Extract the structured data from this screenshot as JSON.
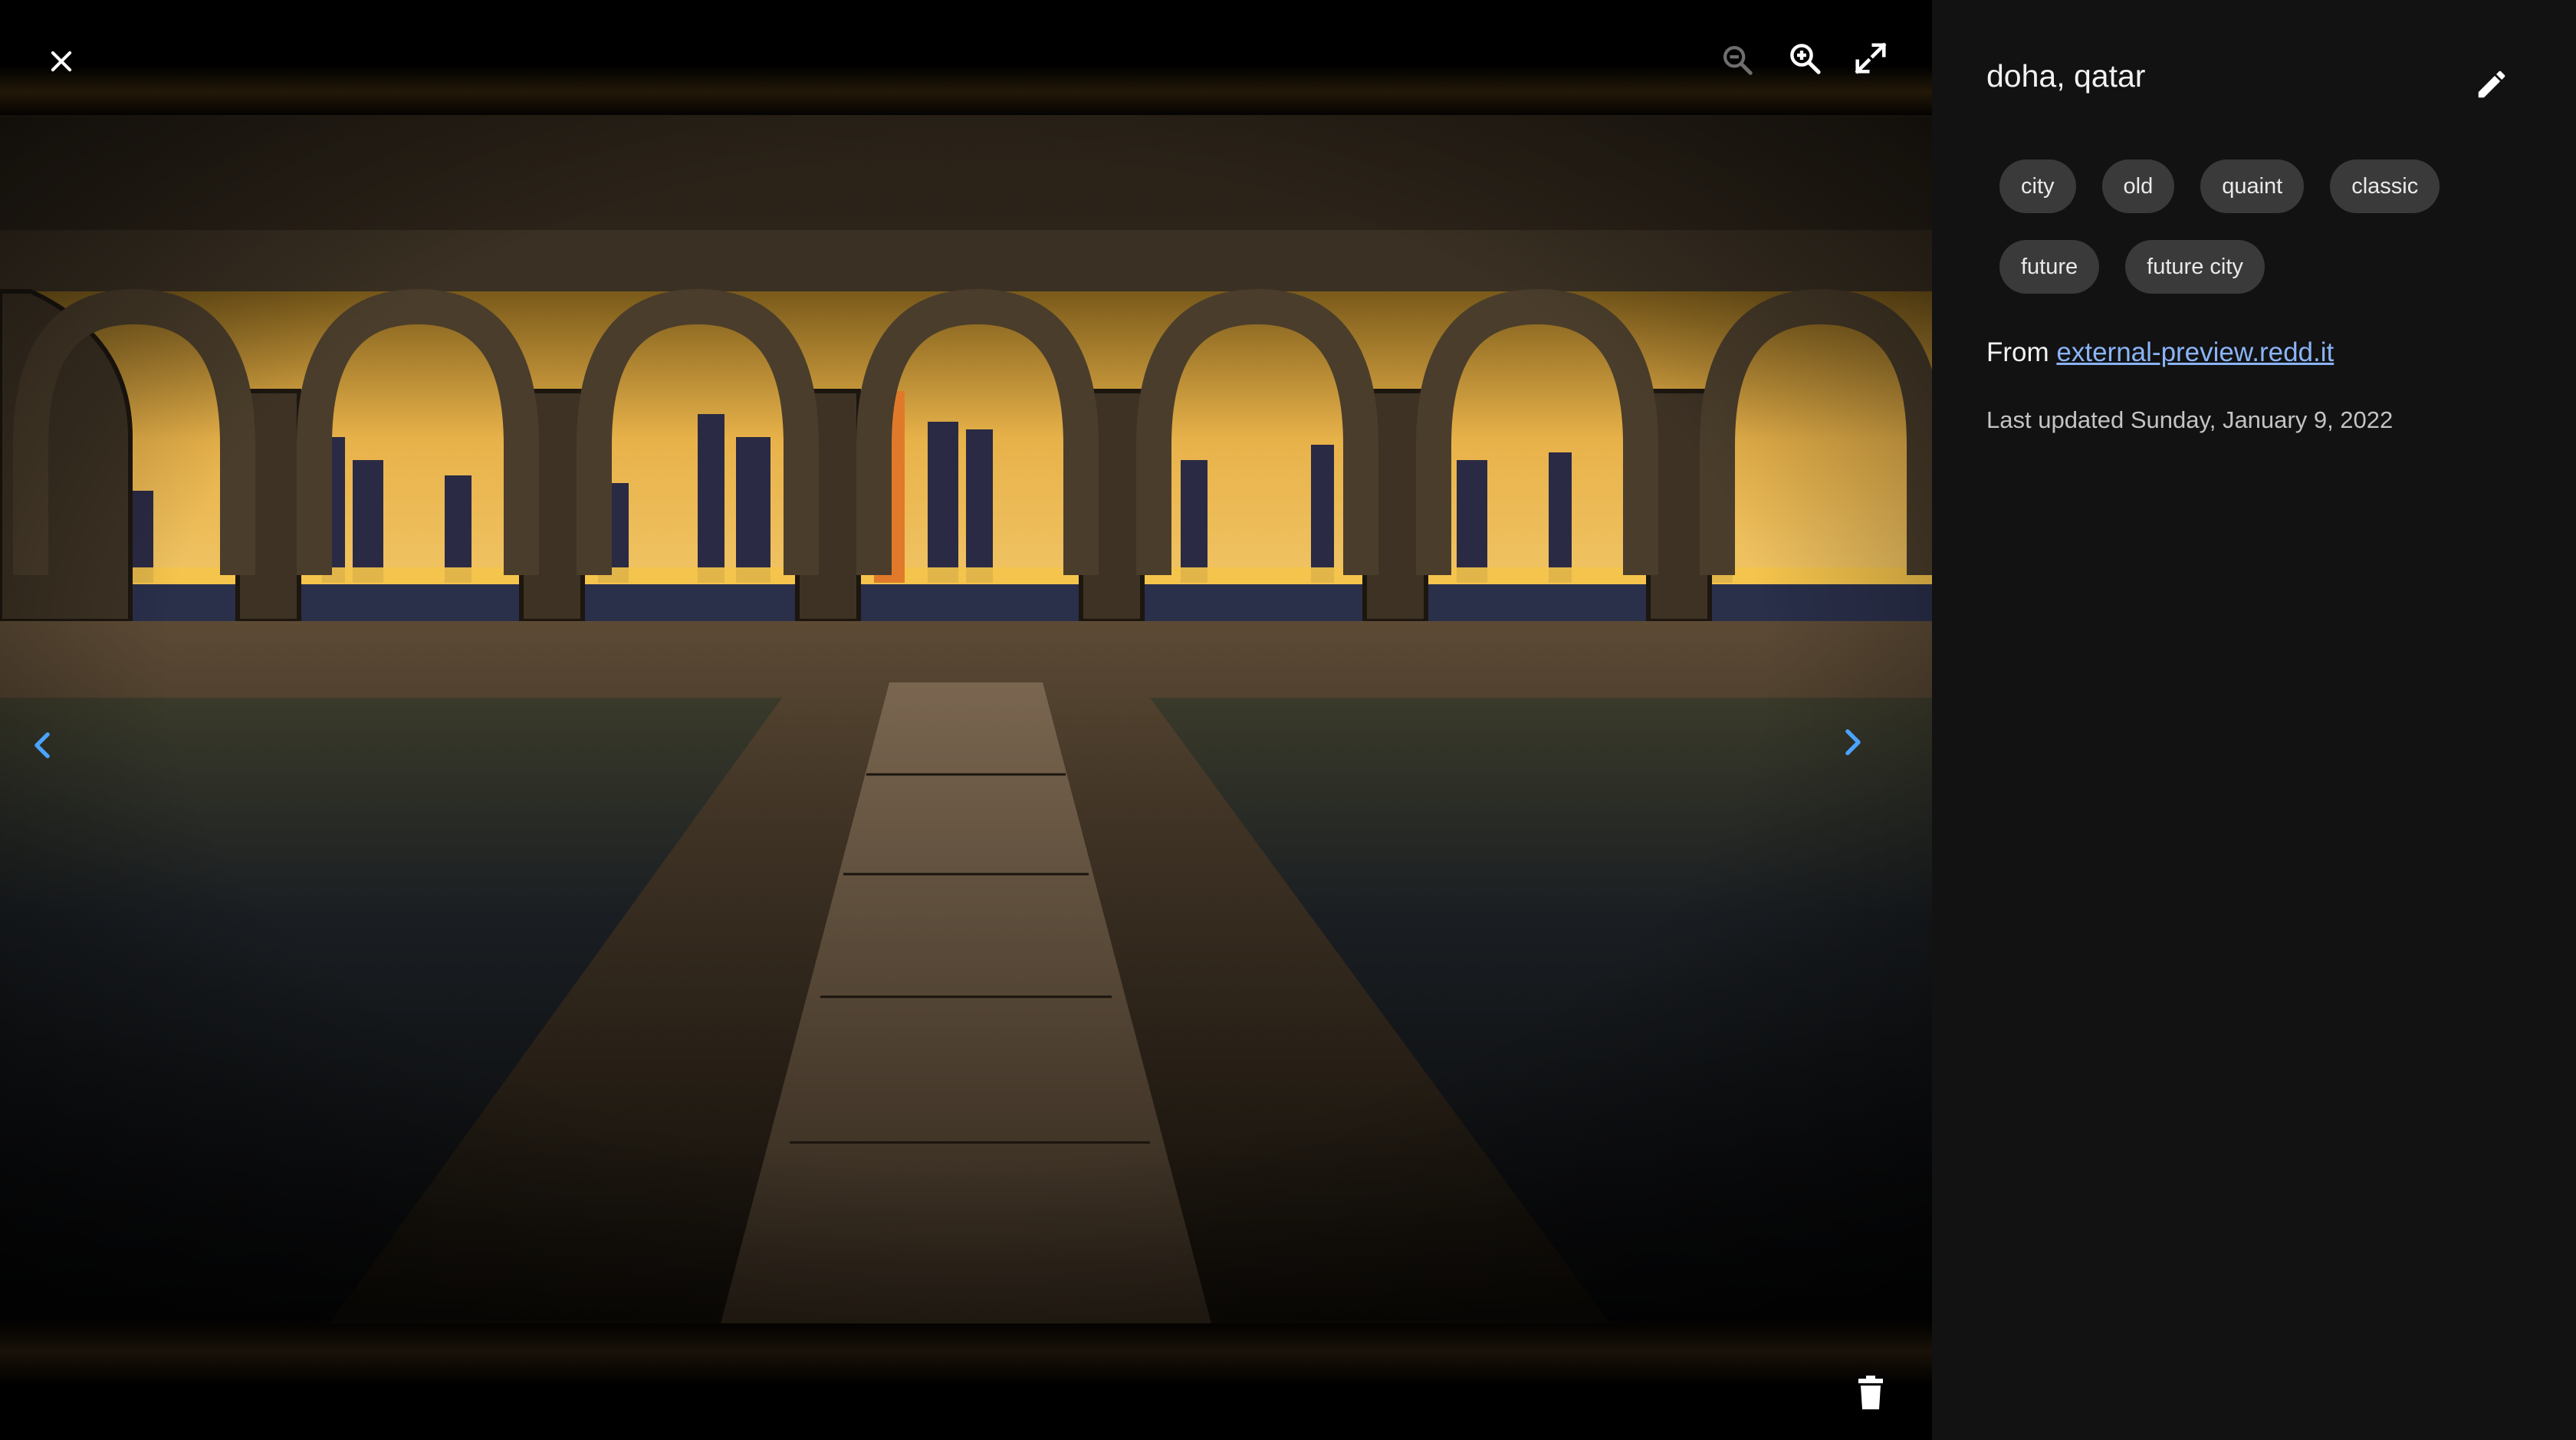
{
  "viewer": {
    "photo_alt": "Arched colonnade overlooking the Doha skyline at dusk, with reflecting pools and a stone walkway",
    "controls": {
      "close": "close-icon",
      "zoom_out": "zoom-out-icon",
      "zoom_in": "zoom-in-icon",
      "fullscreen": "fullscreen-icon",
      "previous": "chevron-left-icon",
      "next": "chevron-right-icon",
      "delete": "trash-icon"
    },
    "colors": {
      "accent": "#4aa3ff",
      "icon": "#ffffff",
      "icon_disabled": "#6e6e6e"
    }
  },
  "panel": {
    "title": "doha, qatar",
    "edit_icon": "pencil-icon",
    "tags": [
      "city",
      "old",
      "quaint",
      "classic",
      "future",
      "future city"
    ],
    "source_prefix": "From",
    "source_link": "external-preview.redd.it",
    "last_updated": "Last updated Sunday, January 9, 2022",
    "colors": {
      "background": "#121212",
      "tag_background": "#3a3a3a",
      "link": "#8ab4f8"
    }
  }
}
